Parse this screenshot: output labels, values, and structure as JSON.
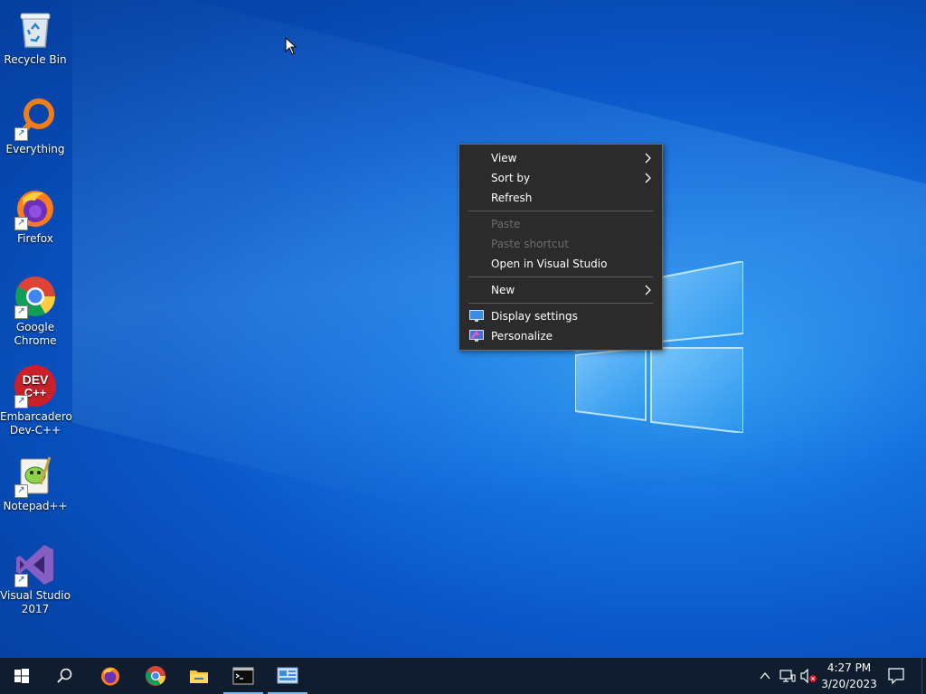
{
  "desktop": {
    "icons": [
      {
        "label": "Recycle Bin",
        "icon": "recycle-bin-icon"
      },
      {
        "label": "Everything",
        "icon": "everything-search-icon"
      },
      {
        "label": "Firefox",
        "icon": "firefox-icon"
      },
      {
        "label": "Google Chrome",
        "icon": "chrome-icon"
      },
      {
        "label": "Embarcadero Dev-C++",
        "icon": "devcpp-icon"
      },
      {
        "label": "Notepad++",
        "icon": "notepadpp-icon"
      },
      {
        "label": "Visual Studio 2017",
        "icon": "visual-studio-icon"
      }
    ],
    "devcpp_logo_text": "DEV C++"
  },
  "context_menu": {
    "view": "View",
    "sort_by": "Sort by",
    "refresh": "Refresh",
    "paste": "Paste",
    "paste_shortcut": "Paste shortcut",
    "open_in_vs": "Open in Visual Studio",
    "new": "New",
    "display_settings": "Display settings",
    "personalize": "Personalize"
  },
  "taskbar": {
    "buttons": [
      "start-icon",
      "search-icon",
      "firefox-icon",
      "chrome-icon",
      "file-explorer-icon",
      "command-prompt-icon",
      "control-panel-icon"
    ],
    "clock": {
      "time": "4:27 PM",
      "date": "3/20/2023"
    }
  },
  "colors": {
    "menu_bg": "#2b2b2b",
    "taskbar_bg": "#0f1d2e",
    "desktop_accent": "#0a56c7"
  }
}
